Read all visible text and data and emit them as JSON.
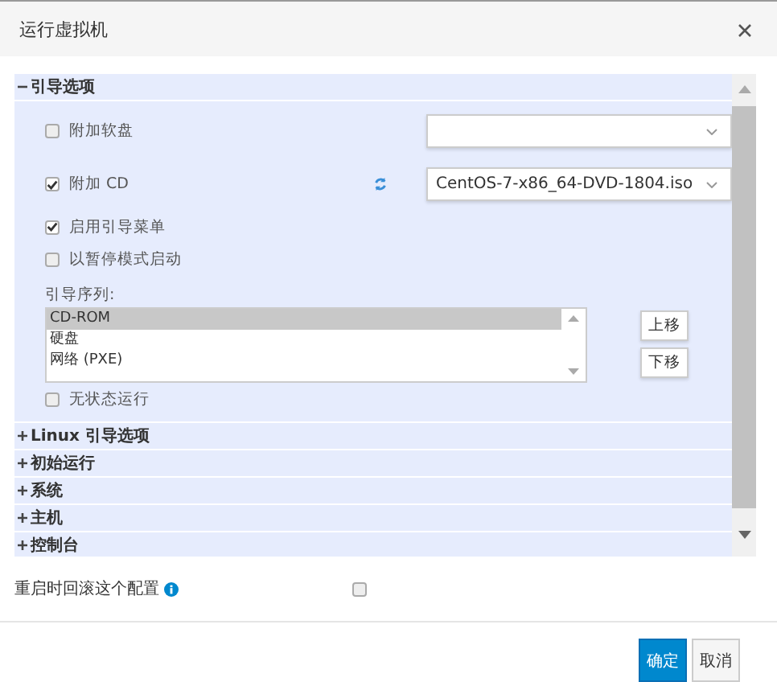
{
  "dialog": {
    "title": "运行虚拟机"
  },
  "sections": [
    {
      "label": "引导选项",
      "expanded": true
    },
    {
      "label": "Linux 引导选项",
      "expanded": false
    },
    {
      "label": "初始运行",
      "expanded": false
    },
    {
      "label": "系统",
      "expanded": false
    },
    {
      "label": "主机",
      "expanded": false
    },
    {
      "label": "控制台",
      "expanded": false
    }
  ],
  "boot_options": {
    "options": [
      {
        "kind": "select",
        "label": "附加软盘",
        "checked": false
      },
      {
        "kind": "select",
        "label": "附加 CD",
        "checked": true,
        "value": "CentOS-7-x86_64-DVD-1804.iso",
        "refresh": true
      },
      {
        "kind": "checkbox",
        "label": "启用引导菜单",
        "checked": true
      },
      {
        "kind": "checkbox",
        "label": "以暂停模式启动",
        "checked": false
      }
    ],
    "boot_sequence": {
      "label": "引导序列:",
      "items": [
        {
          "label": "CD-ROM",
          "selected": true
        },
        {
          "label": "硬盘",
          "selected": false
        },
        {
          "label": "网络 (PXE)",
          "selected": false
        }
      ],
      "buttons": [
        "上移",
        "下移"
      ]
    },
    "stateless": {
      "label": "无状态运行",
      "checked": false
    }
  },
  "rollback": {
    "label": "重启时回滚这个配置",
    "checked": false
  },
  "buttons": [
    {
      "label": "确定",
      "primary": true
    },
    {
      "label": "取消",
      "primary": false
    }
  ]
}
